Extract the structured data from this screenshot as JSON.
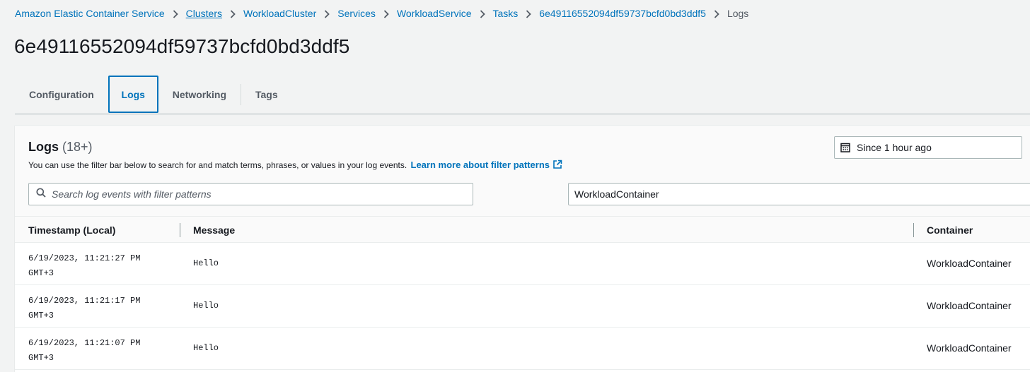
{
  "breadcrumb": {
    "items": [
      {
        "label": "Amazon Elastic Container Service"
      },
      {
        "label": "Clusters"
      },
      {
        "label": "WorkloadCluster"
      },
      {
        "label": "Services"
      },
      {
        "label": "WorkloadService"
      },
      {
        "label": "Tasks"
      },
      {
        "label": "6e49116552094df59737bcfd0bd3ddf5"
      },
      {
        "label": "Logs"
      }
    ]
  },
  "page": {
    "title": "6e49116552094df59737bcfd0bd3ddf5"
  },
  "tabs": [
    {
      "label": "Configuration",
      "active": false
    },
    {
      "label": "Logs",
      "active": true
    },
    {
      "label": "Networking",
      "active": false
    },
    {
      "label": "Tags",
      "active": false
    }
  ],
  "logs": {
    "heading": "Logs",
    "count": "(18+)",
    "description": "You can use the filter bar below to search for and match terms, phrases, or values in your log events.",
    "learn_more": "Learn more about filter patterns",
    "time_range": "Since 1 hour ago",
    "search_placeholder": "Search log events with filter patterns",
    "container_filter": "WorkloadContainer"
  },
  "table": {
    "columns": [
      "Timestamp (Local)",
      "Message",
      "Container"
    ],
    "rows": [
      {
        "ts_line1": "6/19/2023, 11:21:27 PM",
        "ts_line2": "GMT+3",
        "message": "Hello",
        "container": "WorkloadContainer"
      },
      {
        "ts_line1": "6/19/2023, 11:21:17 PM",
        "ts_line2": "GMT+3",
        "message": "Hello",
        "container": "WorkloadContainer"
      },
      {
        "ts_line1": "6/19/2023, 11:21:07 PM",
        "ts_line2": "GMT+3",
        "message": "Hello",
        "container": "WorkloadContainer"
      }
    ]
  },
  "colors": {
    "link": "#0073bb",
    "text": "#16191f",
    "muted": "#545b64",
    "background": "#f2f3f3"
  }
}
